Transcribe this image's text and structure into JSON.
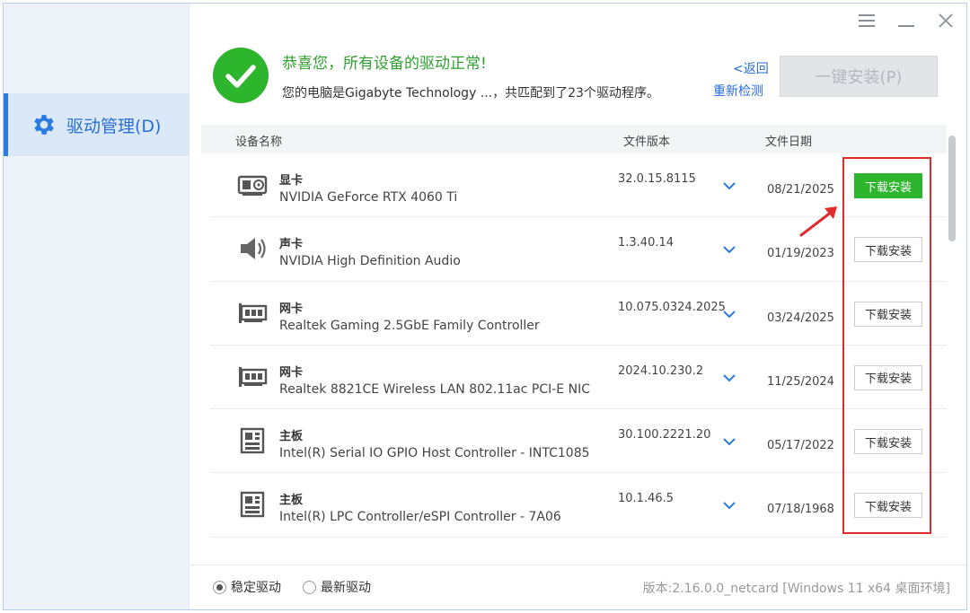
{
  "sidebar": {
    "items": [
      {
        "label": "驱动管理(D)",
        "icon": "gear-icon",
        "active": true
      }
    ]
  },
  "window_controls": {
    "menu_icon": "hamburger-icon",
    "minimize_icon": "minimize-icon",
    "close_icon": "close-icon"
  },
  "status": {
    "icon": "check-circle-icon",
    "title": "恭喜您，所有设备的驱动正常!",
    "description": "您的电脑是Gigabyte Technology ...，共匹配到了23个驱动程序。",
    "back_link": "<返回",
    "rescan_link": "重新检测",
    "one_click_button": "一键安装(P)"
  },
  "table": {
    "headers": {
      "name": "设备名称",
      "version": "文件版本",
      "date": "文件日期"
    },
    "rows": [
      {
        "category": "显卡",
        "name": "NVIDIA GeForce RTX 4060 Ti",
        "version": "32.0.15.8115",
        "date": "08/21/2025",
        "action": "下载安装",
        "icon": "graphics-card-icon",
        "primary": true
      },
      {
        "category": "声卡",
        "name": "NVIDIA High Definition Audio",
        "version": "1.3.40.14",
        "date": "01/19/2023",
        "action": "下载安装",
        "icon": "speaker-icon",
        "primary": false
      },
      {
        "category": "网卡",
        "name": "Realtek Gaming 2.5GbE Family Controller",
        "version": "10.075.0324.2025",
        "date": "03/24/2025",
        "action": "下载安装",
        "icon": "network-card-icon",
        "primary": false
      },
      {
        "category": "网卡",
        "name": "Realtek 8821CE Wireless LAN 802.11ac PCI-E NIC",
        "version": "2024.10.230.2",
        "date": "11/25/2024",
        "action": "下载安装",
        "icon": "network-card-icon",
        "primary": false
      },
      {
        "category": "主板",
        "name": "Intel(R) Serial IO GPIO Host Controller - INTC1085",
        "version": "30.100.2221.20",
        "date": "05/17/2022",
        "action": "下载安装",
        "icon": "motherboard-icon",
        "primary": false
      },
      {
        "category": "主板",
        "name": "Intel(R) LPC Controller/eSPI Controller - 7A06",
        "version": "10.1.46.5",
        "date": "07/18/1968",
        "action": "下载安装",
        "icon": "motherboard-icon",
        "primary": false
      }
    ]
  },
  "footer": {
    "radio_stable": "稳定驱动",
    "radio_latest": "最新驱动",
    "selected": "稳定驱动",
    "version_info": "版本:2.16.0.0_netcard [Windows 11 x64 桌面环境]"
  },
  "colors": {
    "accent_blue": "#2a6fd1",
    "success_green": "#2db52d",
    "highlight_red": "#e02b2b"
  }
}
